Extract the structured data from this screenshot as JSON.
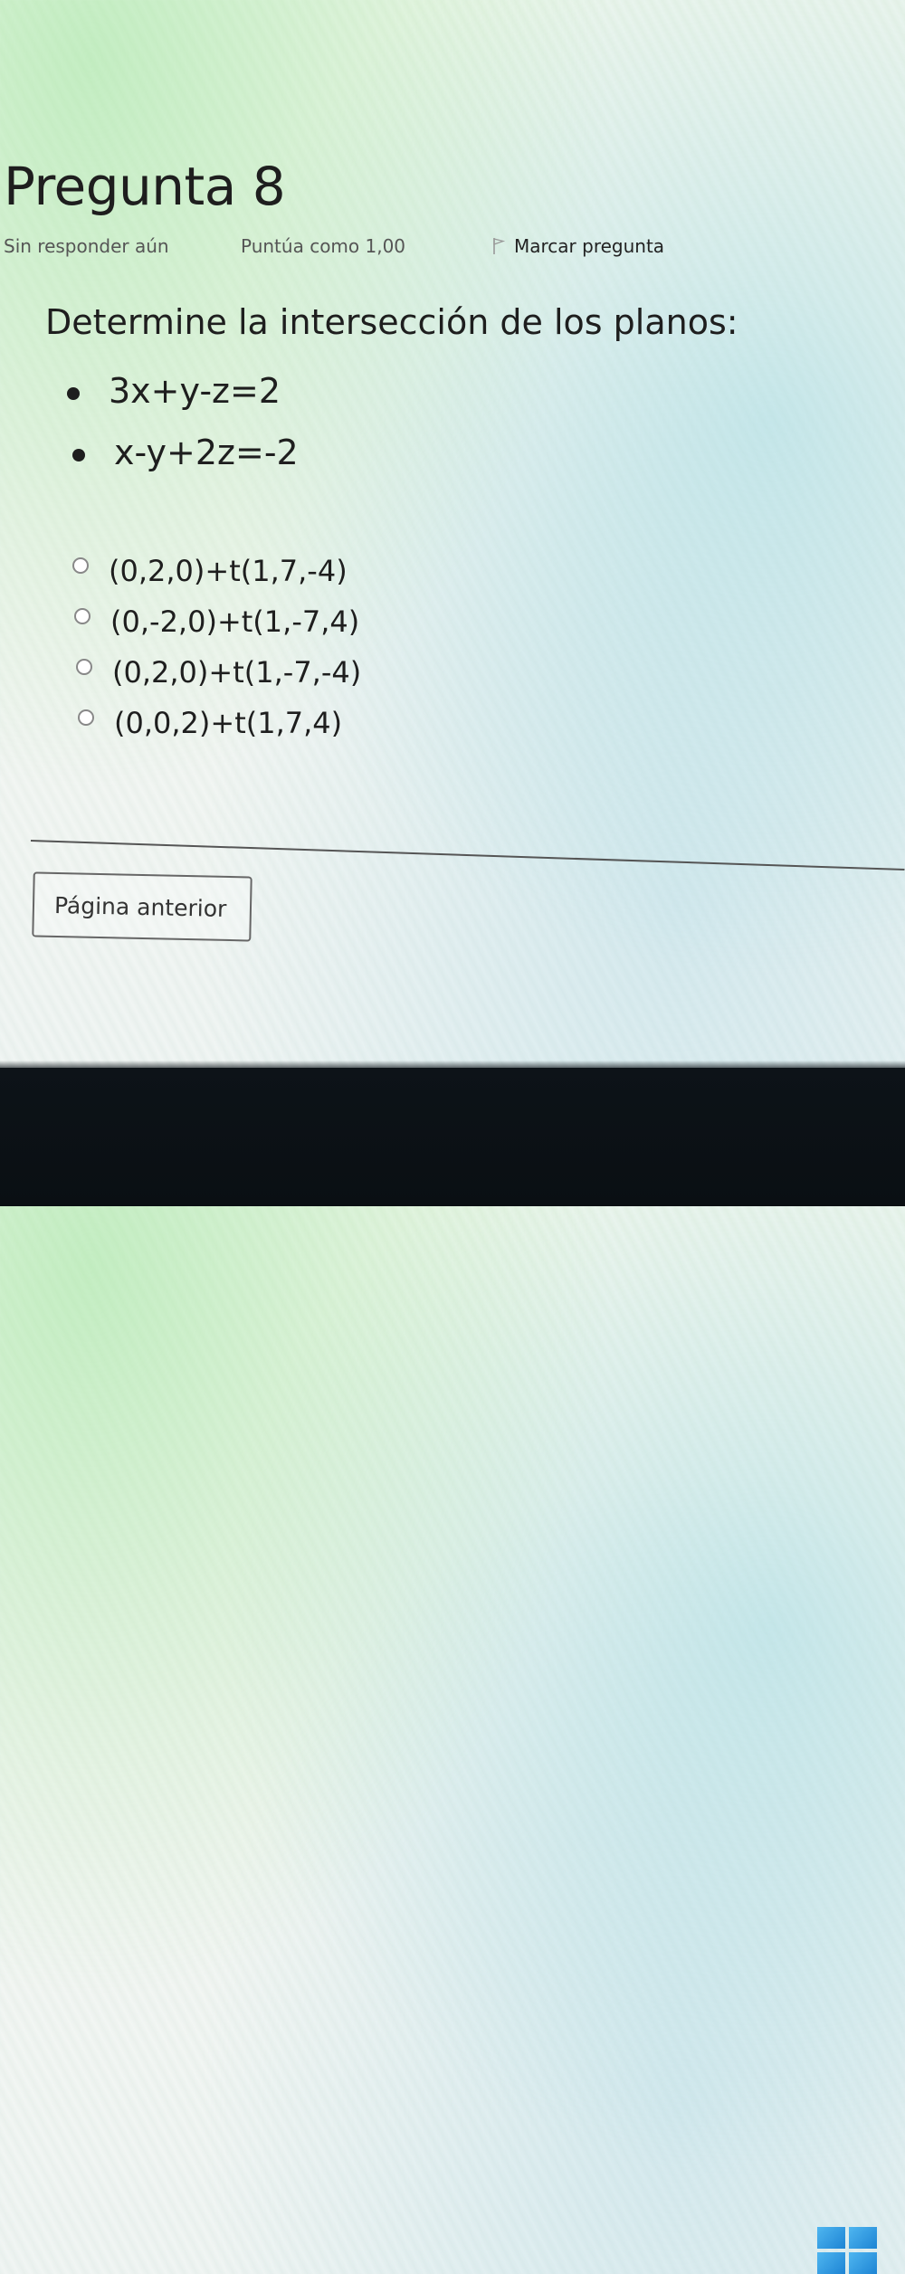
{
  "question": {
    "title": "Pregunta 8",
    "status": "Sin responder aún",
    "grade": "Puntúa como 1,00",
    "flag_label": "Marcar pregunta",
    "text": "Determine la intersección de los planos:",
    "equations": [
      "3x+y-z=2",
      "x-y+2z=-2"
    ],
    "options": [
      "(0,2,0)+t(1,7,-4)",
      "(0,-2,0)+t(1,-7,4)",
      "(0,2,0)+t(1,-7,-4)",
      "(0,0,2)+t(1,7,4)"
    ]
  },
  "navigation": {
    "prev_label": "Página anterior"
  },
  "colors": {
    "windows_accent": "#1d84d4",
    "taskbar": "#0d1318"
  }
}
